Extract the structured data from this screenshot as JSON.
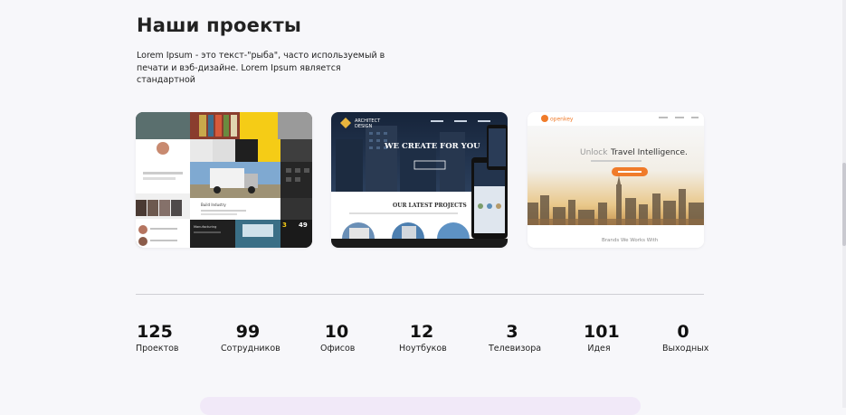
{
  "section": {
    "title": "Наши проекты",
    "description": "Lorem Ipsum - это текст-\"рыба\", часто используемый в печати и вэб-дизайне. Lorem Ipsum является стандартной"
  },
  "projects": [
    {
      "name": "project-card-industry",
      "texts": [
        "Build Industry",
        "Manufacturing",
        "3",
        "49"
      ]
    },
    {
      "name": "project-card-architect",
      "texts": [
        "ARCHITECT",
        "DESIGN",
        "WE CREATE FOR YOU",
        "OUR LATEST PROJECTS"
      ]
    },
    {
      "name": "project-card-openkey",
      "texts": [
        "openkey",
        "Unlock",
        "Travel Intelligence.",
        "Brands We Works With"
      ]
    }
  ],
  "stats": [
    {
      "value": "125",
      "label": "Проектов"
    },
    {
      "value": "99",
      "label": "Сотрудников"
    },
    {
      "value": "10",
      "label": "Офисов"
    },
    {
      "value": "12",
      "label": "Ноутбуков"
    },
    {
      "value": "3",
      "label": "Телевизора"
    },
    {
      "value": "101",
      "label": "Идея"
    },
    {
      "value": "0",
      "label": "Выходных"
    }
  ],
  "colors": {
    "background": "#f7f7fa",
    "accent_yellow": "#f5cc16",
    "accent_orange": "#f07b2a",
    "banner": "#f1e9f8"
  }
}
